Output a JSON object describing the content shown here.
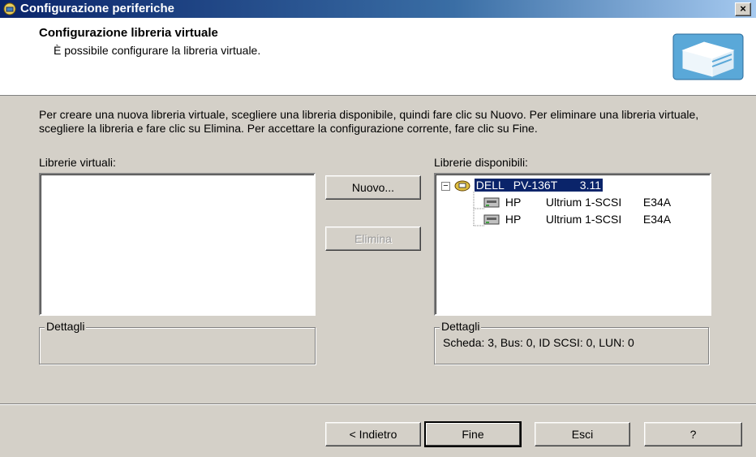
{
  "window": {
    "title": "Configurazione periferiche",
    "close_label": "×"
  },
  "header": {
    "title": "Configurazione libreria virtuale",
    "subtitle": "È possibile configurare la libreria virtuale."
  },
  "description": "Per creare una nuova libreria virtuale, scegliere una libreria disponibile, quindi fare clic su Nuovo. Per eliminare una libreria virtuale, scegliere la libreria e fare clic su Elimina. Per accettare la configurazione corrente, fare clic su Fine.",
  "virtual_libraries": {
    "label": "Librerie virtuali:",
    "items": []
  },
  "available_libraries": {
    "label": "Librerie disponibili:",
    "tree": {
      "expander": "−",
      "root": {
        "vendor": "DELL",
        "model": "PV-136T",
        "rev": "3.11",
        "selected": true
      },
      "children": [
        {
          "vendor": "HP",
          "model": "Ultrium 1-SCSI",
          "rev": "E34A"
        },
        {
          "vendor": "HP",
          "model": "Ultrium 1-SCSI",
          "rev": "E34A"
        }
      ]
    }
  },
  "buttons": {
    "new": "Nuovo...",
    "delete": "Elimina",
    "back": "< Indietro",
    "finish": "Fine",
    "exit": "Esci",
    "help": "?"
  },
  "details_left": {
    "legend": "Dettagli",
    "text": ""
  },
  "details_right": {
    "legend": "Dettagli",
    "text": "Scheda: 3, Bus: 0, ID SCSI: 0, LUN: 0"
  },
  "icons": {
    "app": "devices-config-icon",
    "header": "tape-library-icon",
    "library": "library-device-icon",
    "drive": "tape-drive-icon"
  }
}
